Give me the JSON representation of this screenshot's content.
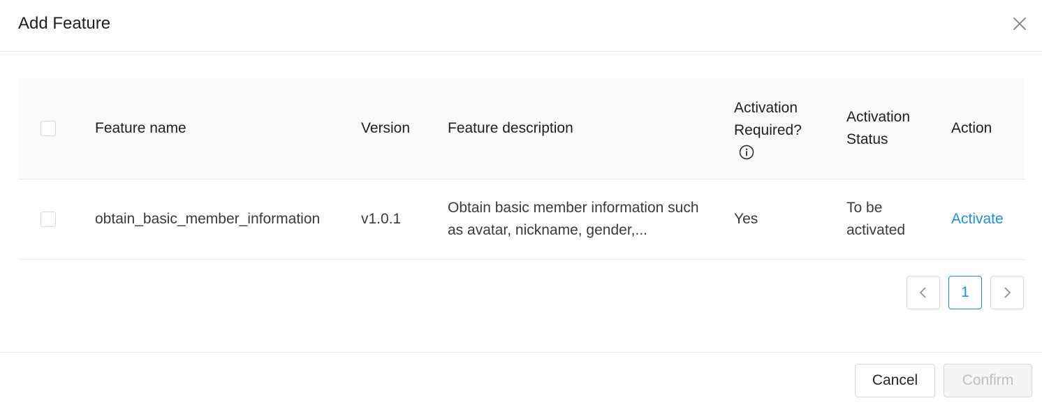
{
  "dialog": {
    "title": "Add Feature",
    "close_icon": "close-icon"
  },
  "table": {
    "columns": {
      "name": "Feature name",
      "version": "Version",
      "description": "Feature description",
      "activation_required": "Activation Required?",
      "activation_status": "Activation Status",
      "action": "Action"
    },
    "info_icon": "info-circle-icon",
    "rows": [
      {
        "checked": false,
        "name": "obtain_basic_member_information",
        "version": "v1.0.1",
        "description": "Obtain basic member information such as avatar, nickname, gender,...",
        "activation_required": "Yes",
        "activation_status": "To be activated",
        "action": "Activate"
      }
    ]
  },
  "pagination": {
    "prev_icon": "chevron-left-icon",
    "current_page": "1",
    "next_icon": "chevron-right-icon"
  },
  "footer": {
    "cancel_label": "Cancel",
    "confirm_label": "Confirm"
  },
  "colors": {
    "accent": "#1a8fe0",
    "border": "#d9d9d9",
    "header_bg": "#fafafa",
    "disabled_text": "#bfbfbf"
  }
}
